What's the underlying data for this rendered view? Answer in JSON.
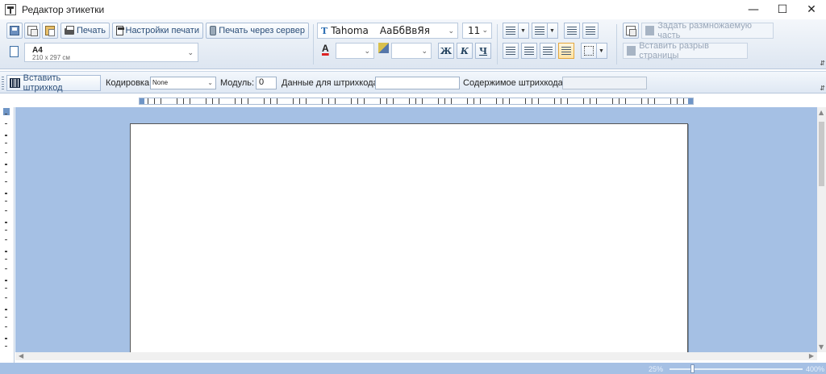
{
  "window": {
    "title": "Редактор этикетки",
    "minimize": "—",
    "maximize": "☐",
    "close": "✕"
  },
  "ribbon": {
    "print_label": "Печать",
    "print_settings_label": "Настройки печати",
    "print_server_label": "Печать через сервер",
    "paper": {
      "name": "A4",
      "size": "210 x 297 см"
    },
    "font": {
      "name": "Tahoma",
      "sample": "АаБбВвЯя",
      "size": "11"
    },
    "bold": "Ж",
    "italic": "К",
    "underline": "Ч",
    "set_repeat_label": "Задать размножаемую часть",
    "insert_page_break_label": "Вставить разрыв страницы"
  },
  "barcode_bar": {
    "insert_barcode_label": "Вставить штрихкод",
    "encoding_label": "Кодировка:",
    "encoding_value": "None",
    "module_label": "Модуль:",
    "module_value": "0",
    "data_label": "Данные для штрихкода:",
    "data_value": "",
    "content_label": "Содержимое штрихкода:",
    "content_value": ""
  },
  "status": {
    "zoom_min": "25%",
    "zoom_max": "400%",
    "zoom_level": 0.17
  }
}
